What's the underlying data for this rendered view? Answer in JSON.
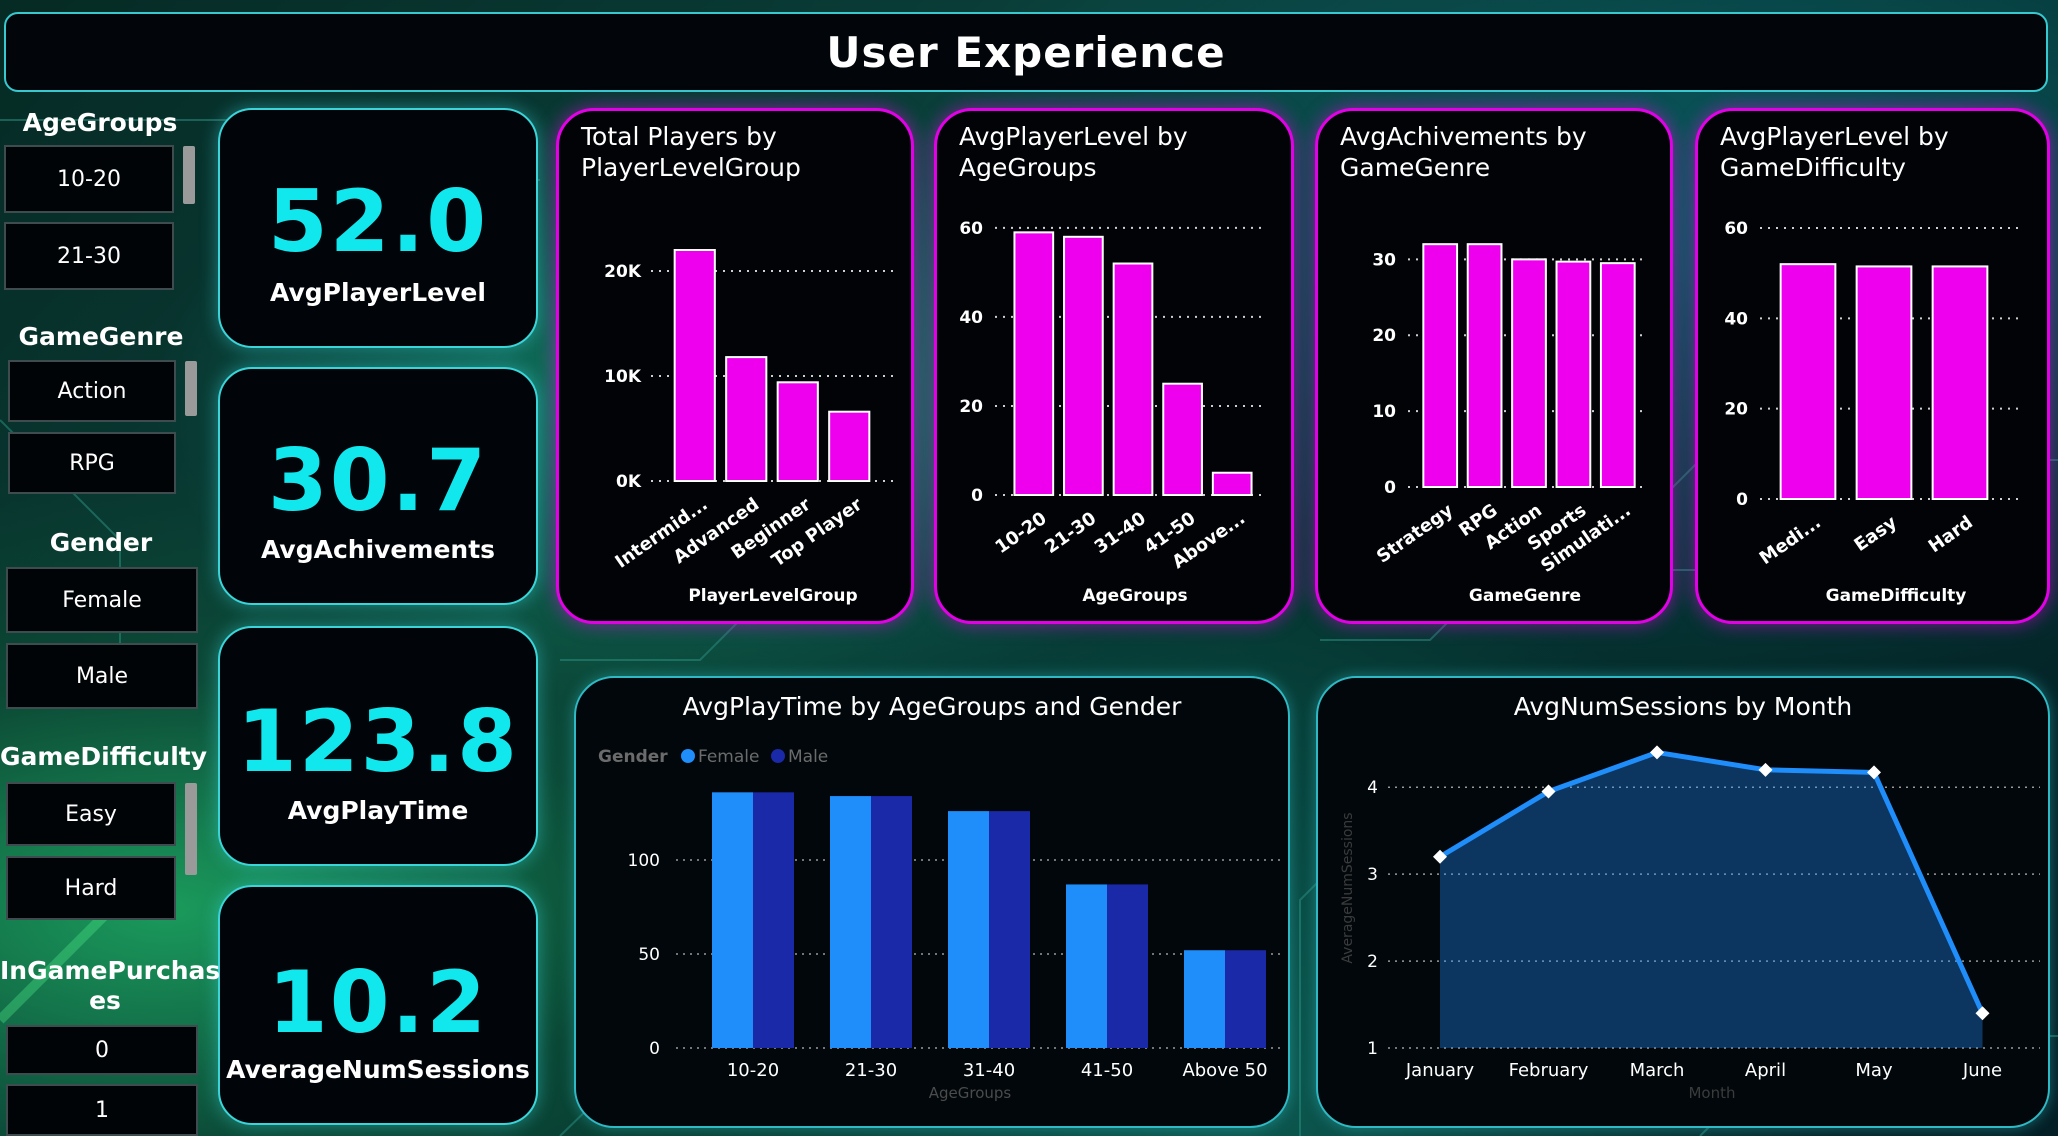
{
  "header": {
    "title": "User Experience"
  },
  "slicers": {
    "age_groups": {
      "title": "AgeGroups",
      "items": [
        "10-20",
        "21-30"
      ]
    },
    "game_genre": {
      "title": "GameGenre",
      "items": [
        "Action",
        "RPG"
      ]
    },
    "gender": {
      "title": "Gender",
      "items": [
        "Female",
        "Male"
      ]
    },
    "game_difficulty": {
      "title": "GameDifficulty",
      "items": [
        "Easy",
        "Hard"
      ]
    },
    "in_game_purchases": {
      "title_line1": "InGamePurchas",
      "title_line2": "es",
      "items": [
        "0",
        "1"
      ]
    }
  },
  "kpis": [
    {
      "value": "52.0",
      "label": "AvgPlayerLevel"
    },
    {
      "value": "30.7",
      "label": "AvgAchivements"
    },
    {
      "value": "123.8",
      "label": "AvgPlayTime"
    },
    {
      "value": "10.2",
      "label": "AverageNumSessions"
    }
  ],
  "colors": {
    "magenta_bar": "#ee00ee",
    "female": "#1f8efb",
    "male": "#1a29a8",
    "line": "#1f8efb",
    "kpi_value": "#10e8ee"
  },
  "chart_data": [
    {
      "type": "bar",
      "title_line1": "Total Players by",
      "title_line2": "PlayerLevelGroup",
      "xlabel": "PlayerLevelGroup",
      "categories": [
        "Intermid...",
        "Advanced",
        "Beginner",
        "Top Player"
      ],
      "values": [
        22000,
        11800,
        9400,
        6600
      ],
      "ylim": [
        0,
        24000
      ],
      "ticks": [
        0,
        10000,
        20000
      ],
      "tick_labels": [
        "0K",
        "10K",
        "20K"
      ]
    },
    {
      "type": "bar",
      "title_line1": "AvgPlayerLevel by",
      "title_line2": "AgeGroups",
      "xlabel": "AgeGroups",
      "categories": [
        "10-20",
        "21-30",
        "31-40",
        "41-50",
        "Above..."
      ],
      "values": [
        59,
        58,
        52,
        25,
        5
      ],
      "ylim": [
        0,
        62
      ],
      "ticks": [
        0,
        20,
        40,
        60
      ],
      "tick_labels": [
        "0",
        "20",
        "40",
        "60"
      ]
    },
    {
      "type": "bar",
      "title_line1": "AvgAchivements by",
      "title_line2": "GameGenre",
      "xlabel": "GameGenre",
      "categories": [
        "Strategy",
        "RPG",
        "Action",
        "Sports",
        "Simulati..."
      ],
      "values": [
        32,
        32,
        30,
        29.7,
        29.5
      ],
      "ylim": [
        0,
        34
      ],
      "ticks": [
        0,
        10,
        20,
        30
      ],
      "tick_labels": [
        "0",
        "10",
        "20",
        "30"
      ]
    },
    {
      "type": "bar",
      "title_line1": "AvgPlayerLevel by",
      "title_line2": "GameDifficulty",
      "xlabel": "GameDifficulty",
      "categories": [
        "Medi...",
        "Easy",
        "Hard"
      ],
      "values": [
        52,
        51.5,
        51.5
      ],
      "ylim": [
        0,
        62
      ],
      "ticks": [
        0,
        20,
        40,
        60
      ],
      "tick_labels": [
        "0",
        "20",
        "40",
        "60"
      ]
    },
    {
      "type": "bar",
      "title": "AvgPlayTime by AgeGroups and Gender",
      "legend_title": "Gender",
      "xlabel": "AgeGroups",
      "categories": [
        "10-20",
        "21-30",
        "31-40",
        "41-50",
        "Above 50"
      ],
      "series": [
        {
          "name": "Female",
          "values": [
            136,
            134,
            126,
            87,
            52
          ]
        },
        {
          "name": "Male",
          "values": [
            136,
            134,
            126,
            87,
            52
          ]
        }
      ],
      "ylim": [
        0,
        150
      ],
      "ticks": [
        0,
        50,
        100
      ],
      "tick_labels": [
        "0",
        "50",
        "100"
      ]
    },
    {
      "type": "area",
      "title": "AvgNumSessions by Month",
      "xlabel": "Month",
      "ylabel": "AverageNumSessions",
      "categories": [
        "January",
        "February",
        "March",
        "April",
        "May",
        "June"
      ],
      "values": [
        3.2,
        3.95,
        4.4,
        4.2,
        4.17,
        1.4
      ],
      "ylim": [
        1,
        4.75
      ],
      "ticks": [
        1,
        2,
        3,
        4
      ],
      "tick_labels": [
        "1",
        "2",
        "3",
        "4"
      ]
    }
  ]
}
